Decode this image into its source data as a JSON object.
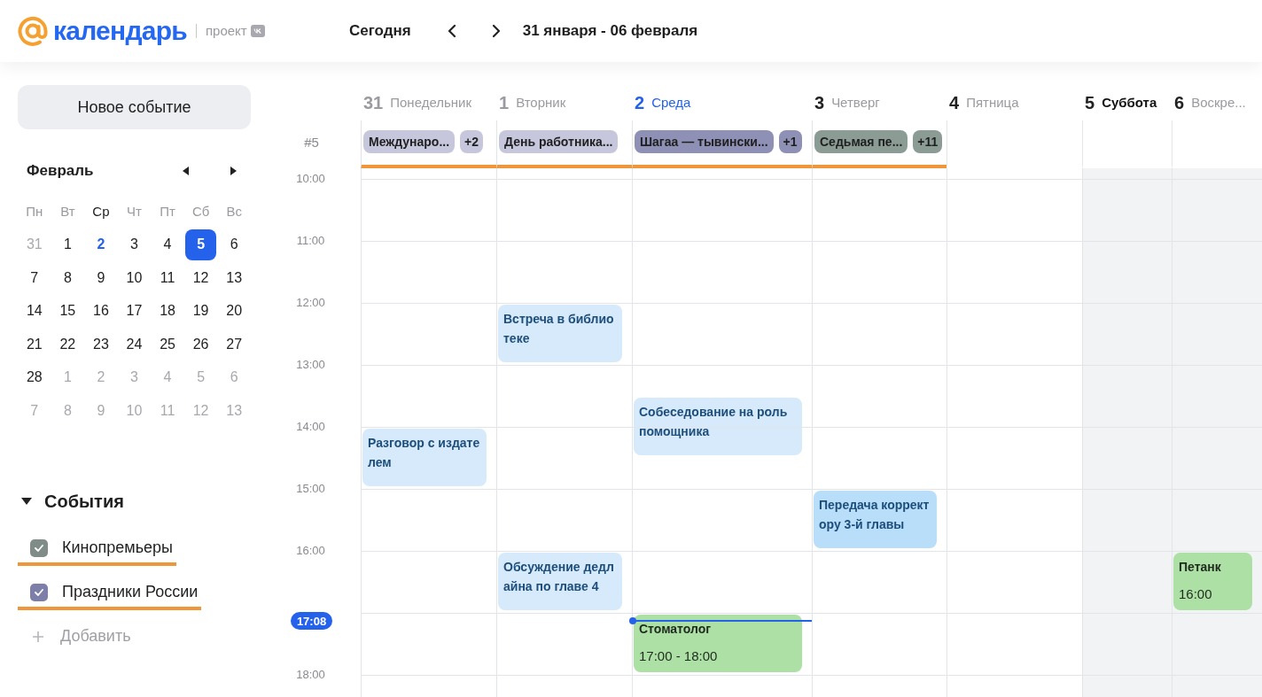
{
  "header": {
    "logo_text": "календарь",
    "project_label": "проект",
    "today_button": "Сегодня",
    "date_range": "31 января - 06 февраля"
  },
  "sidebar": {
    "new_event_button": "Новое событие",
    "mini_calendar": {
      "month": "Февраль",
      "weekdays": [
        {
          "label": "Пн",
          "today": false
        },
        {
          "label": "Вт",
          "today": false
        },
        {
          "label": "Ср",
          "today": true
        },
        {
          "label": "Чт",
          "today": false
        },
        {
          "label": "Пт",
          "today": false
        },
        {
          "label": "Сб",
          "today": false
        },
        {
          "label": "Вс",
          "today": false
        }
      ],
      "weeks": [
        [
          {
            "label": "31",
            "muted": true,
            "today": false,
            "selected": false
          },
          {
            "label": "1",
            "muted": false,
            "today": false,
            "selected": false
          },
          {
            "label": "2",
            "muted": false,
            "today": true,
            "selected": false
          },
          {
            "label": "3",
            "muted": false,
            "today": false,
            "selected": false
          },
          {
            "label": "4",
            "muted": false,
            "today": false,
            "selected": false
          },
          {
            "label": "5",
            "muted": false,
            "today": false,
            "selected": true
          },
          {
            "label": "6",
            "muted": false,
            "today": false,
            "selected": false
          }
        ],
        [
          {
            "label": "7",
            "muted": false,
            "today": false,
            "selected": false
          },
          {
            "label": "8",
            "muted": false,
            "today": false,
            "selected": false
          },
          {
            "label": "9",
            "muted": false,
            "today": false,
            "selected": false
          },
          {
            "label": "10",
            "muted": false,
            "today": false,
            "selected": false
          },
          {
            "label": "11",
            "muted": false,
            "today": false,
            "selected": false
          },
          {
            "label": "12",
            "muted": false,
            "today": false,
            "selected": false
          },
          {
            "label": "13",
            "muted": false,
            "today": false,
            "selected": false
          }
        ],
        [
          {
            "label": "14",
            "muted": false,
            "today": false,
            "selected": false
          },
          {
            "label": "15",
            "muted": false,
            "today": false,
            "selected": false
          },
          {
            "label": "16",
            "muted": false,
            "today": false,
            "selected": false
          },
          {
            "label": "17",
            "muted": false,
            "today": false,
            "selected": false
          },
          {
            "label": "18",
            "muted": false,
            "today": false,
            "selected": false
          },
          {
            "label": "19",
            "muted": false,
            "today": false,
            "selected": false
          },
          {
            "label": "20",
            "muted": false,
            "today": false,
            "selected": false
          }
        ],
        [
          {
            "label": "21",
            "muted": false,
            "today": false,
            "selected": false
          },
          {
            "label": "22",
            "muted": false,
            "today": false,
            "selected": false
          },
          {
            "label": "23",
            "muted": false,
            "today": false,
            "selected": false
          },
          {
            "label": "24",
            "muted": false,
            "today": false,
            "selected": false
          },
          {
            "label": "25",
            "muted": false,
            "today": false,
            "selected": false
          },
          {
            "label": "26",
            "muted": false,
            "today": false,
            "selected": false
          },
          {
            "label": "27",
            "muted": false,
            "today": false,
            "selected": false
          }
        ],
        [
          {
            "label": "28",
            "muted": false,
            "today": false,
            "selected": false
          },
          {
            "label": "1",
            "muted": true,
            "today": false,
            "selected": false
          },
          {
            "label": "2",
            "muted": true,
            "today": false,
            "selected": false
          },
          {
            "label": "3",
            "muted": true,
            "today": false,
            "selected": false
          },
          {
            "label": "4",
            "muted": true,
            "today": false,
            "selected": false
          },
          {
            "label": "5",
            "muted": true,
            "today": false,
            "selected": false
          },
          {
            "label": "6",
            "muted": true,
            "today": false,
            "selected": false
          }
        ],
        [
          {
            "label": "7",
            "muted": true,
            "today": false,
            "selected": false
          },
          {
            "label": "8",
            "muted": true,
            "today": false,
            "selected": false
          },
          {
            "label": "9",
            "muted": true,
            "today": false,
            "selected": false
          },
          {
            "label": "10",
            "muted": true,
            "today": false,
            "selected": false
          },
          {
            "label": "11",
            "muted": true,
            "today": false,
            "selected": false
          },
          {
            "label": "12",
            "muted": true,
            "today": false,
            "selected": false
          },
          {
            "label": "13",
            "muted": true,
            "today": false,
            "selected": false
          }
        ]
      ]
    },
    "events_section": {
      "title": "События",
      "expanded": true,
      "calendars": [
        {
          "label": "Кинопремьеры",
          "checked": true,
          "color": "#7f8c88",
          "underlined": true
        },
        {
          "label": "Праздники России",
          "checked": true,
          "color": "#7e7fa8",
          "underlined": true
        }
      ],
      "add_label": "Добавить"
    }
  },
  "week": {
    "week_number": "#5",
    "hours": [
      "10:00",
      "11:00",
      "12:00",
      "13:00",
      "14:00",
      "15:00",
      "16:00",
      "18:00"
    ],
    "now": {
      "label": "17:08"
    },
    "days": [
      {
        "number": "31",
        "name": "Понедельник",
        "past": true,
        "today": false,
        "selected": false,
        "weekend": false,
        "underlined": true,
        "all_day": [
          {
            "title": "Междунаро...",
            "color": "#c6c7dc"
          }
        ],
        "more": {
          "label": "+2",
          "color": "#c6c7dc"
        },
        "events": [
          {
            "kind": "meeting",
            "title": "Разговор с издателем",
            "color": "#d7eafb"
          }
        ]
      },
      {
        "number": "1",
        "name": "Вторник",
        "past": true,
        "today": false,
        "selected": false,
        "weekend": false,
        "underlined": true,
        "all_day": [
          {
            "title": "День работника...",
            "color": "#c6c7dc"
          }
        ],
        "events": [
          {
            "kind": "meeting",
            "title": "Встреча в библиотеке",
            "color": "#d7eafb"
          },
          {
            "kind": "meeting",
            "title": "Обсуждение дедлайна по главе 4",
            "color": "#d7eafb"
          }
        ]
      },
      {
        "number": "2",
        "name": "Среда",
        "past": false,
        "today": true,
        "selected": false,
        "weekend": false,
        "underlined": true,
        "all_day": [
          {
            "title": "Шагаа — тывински...",
            "color": "#8e90b5"
          }
        ],
        "more": {
          "label": "+1",
          "color": "#8e90b5"
        },
        "events": [
          {
            "kind": "meeting",
            "title": "Собеседование на роль помощника",
            "color": "#d7eafb"
          },
          {
            "kind": "appointment",
            "title": "Стоматолог",
            "time": "17:00 - 18:00",
            "color": "#ade0a5"
          }
        ]
      },
      {
        "number": "3",
        "name": "Четверг",
        "past": false,
        "today": false,
        "selected": false,
        "weekend": false,
        "underlined": true,
        "all_day": [
          {
            "title": "Седьмая пе...",
            "color": "#8b9c95"
          }
        ],
        "more": {
          "label": "+11",
          "color": "#8b9c95"
        },
        "events": [
          {
            "kind": "meeting",
            "title": "Передача корректору 3-й главы",
            "color": "#b9defa"
          }
        ]
      },
      {
        "number": "4",
        "name": "Пятница",
        "past": false,
        "today": false,
        "selected": false,
        "weekend": false,
        "underlined": false
      },
      {
        "number": "5",
        "name": "Суббота",
        "past": false,
        "today": false,
        "selected": true,
        "weekend": true,
        "underlined": false
      },
      {
        "number": "6",
        "name": "Воскре...",
        "past": false,
        "today": false,
        "selected": false,
        "weekend": true,
        "underlined": false,
        "events": [
          {
            "kind": "appointment",
            "title": "Петанк",
            "time": "16:00",
            "color": "#ade0a5"
          }
        ]
      }
    ]
  }
}
